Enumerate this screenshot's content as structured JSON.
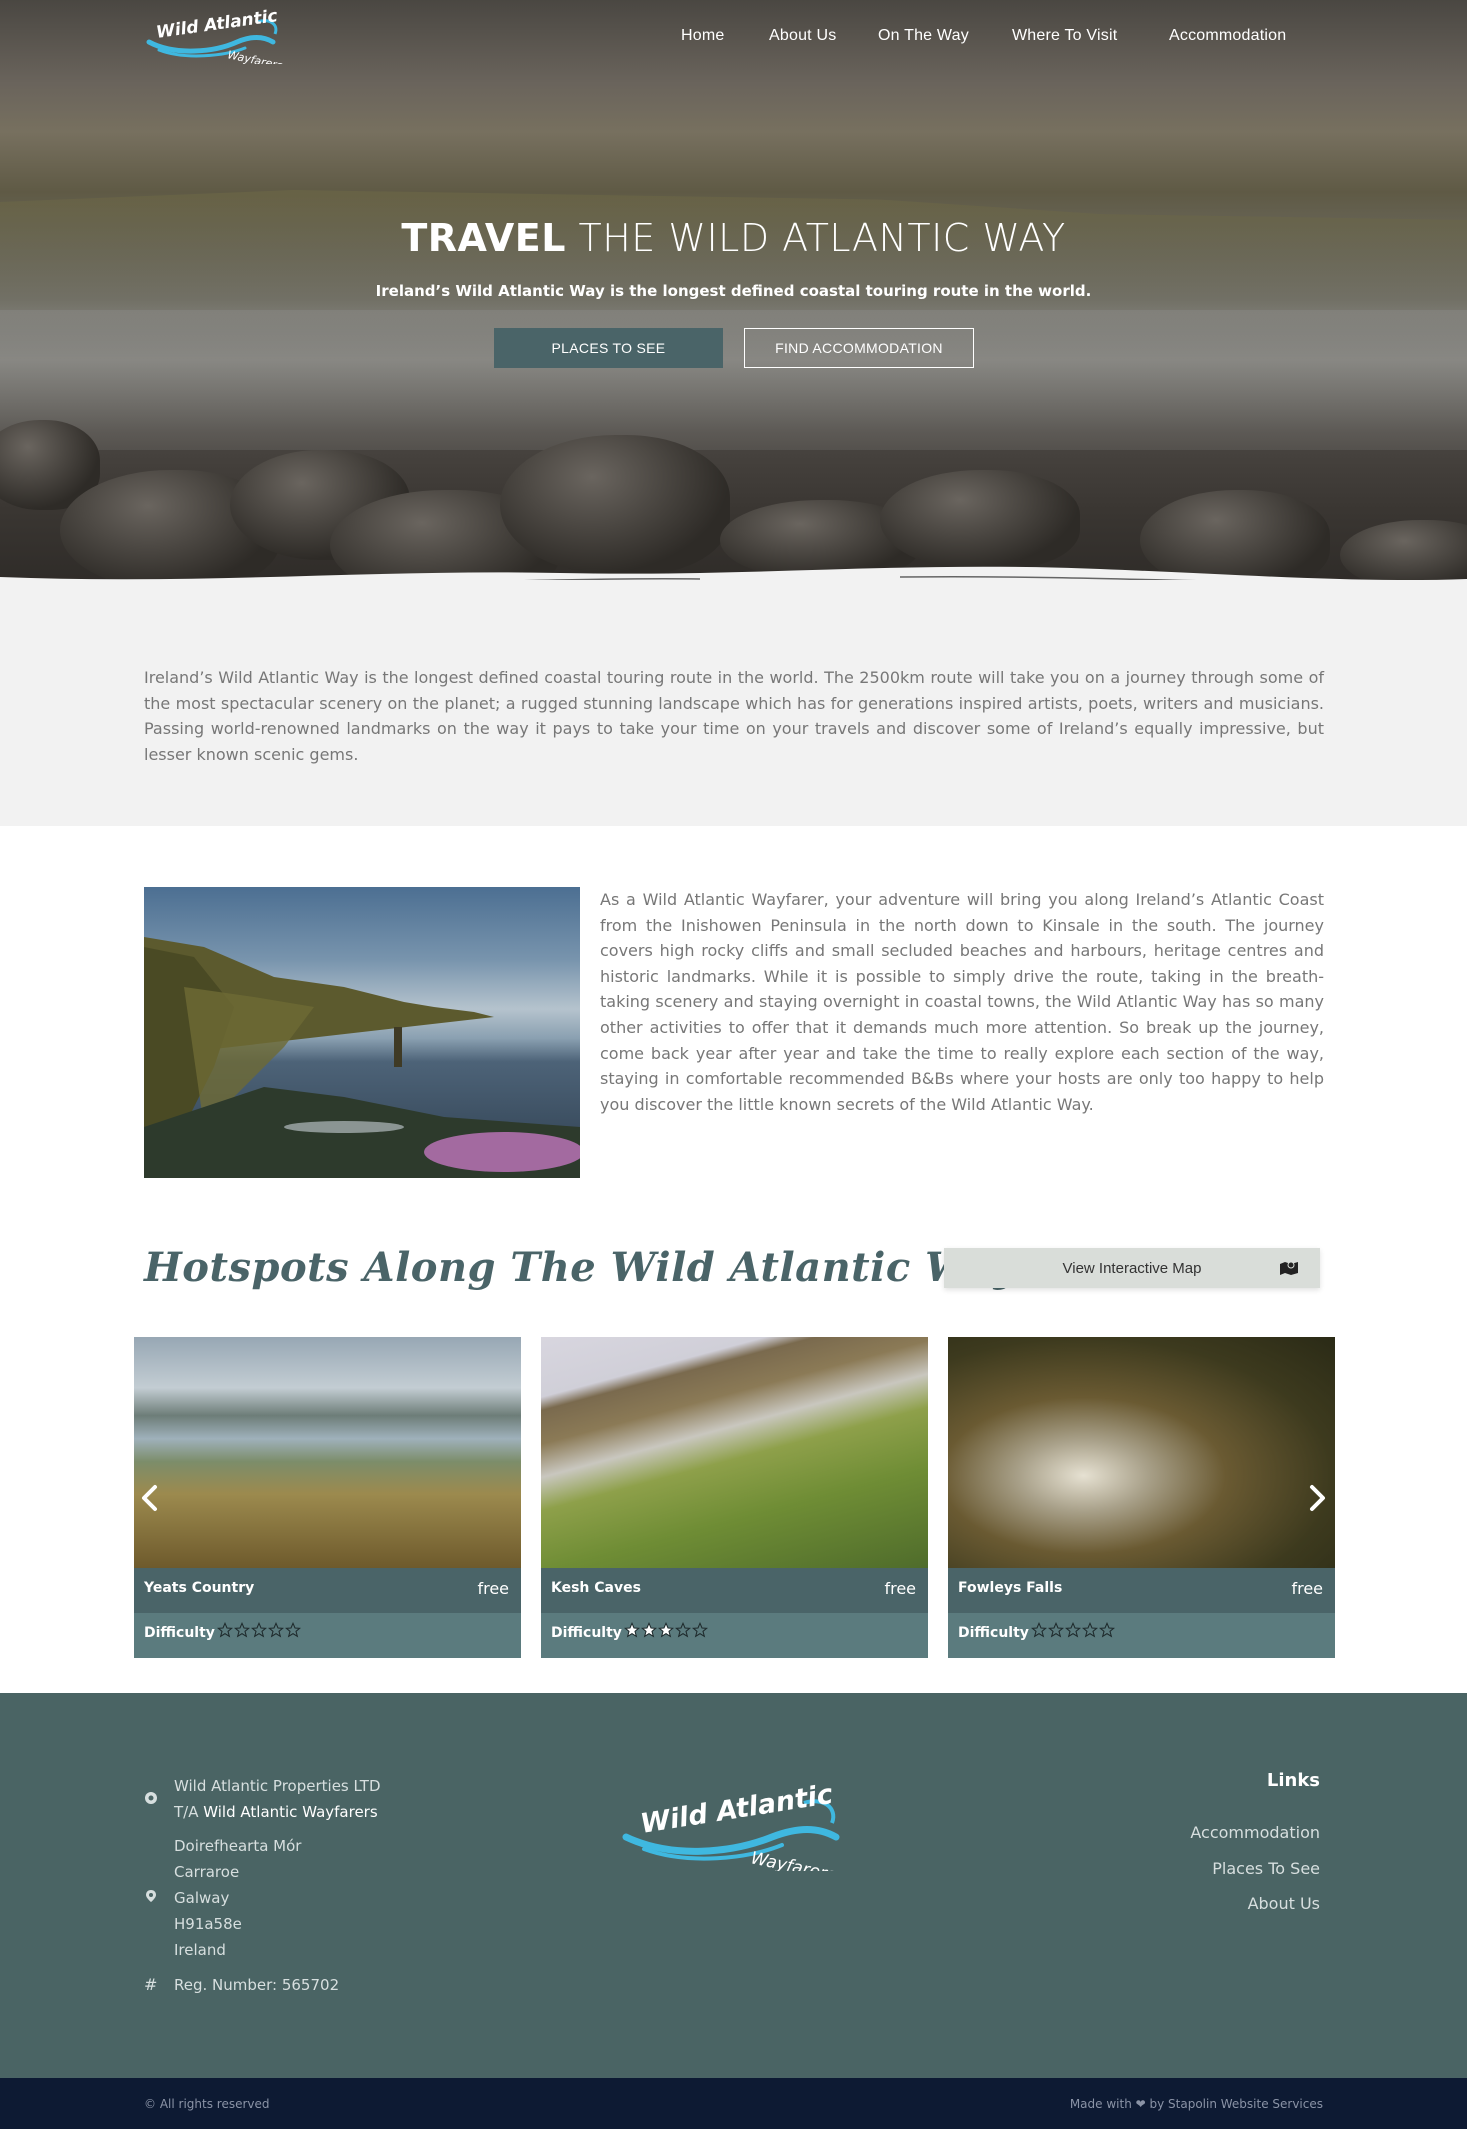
{
  "brand": {
    "logo_line1": "Wild Atlantic",
    "logo_line2": "Wayfarers"
  },
  "nav": {
    "items": [
      {
        "label": "Home"
      },
      {
        "label": "About Us"
      },
      {
        "label": "On The Way"
      },
      {
        "label": "Where To Visit"
      },
      {
        "label": "Accommodation"
      }
    ]
  },
  "hero": {
    "title_bold": "TRAVEL",
    "title_light": "THE WILD ATLANTIC WAY",
    "subtitle": "Ireland’s Wild Atlantic Way is the longest defined coastal touring route in the world.",
    "primary_button": "PLACES TO SEE",
    "secondary_button": "FIND ACCOMMODATION"
  },
  "intro": {
    "text": "Ireland’s Wild Atlantic Way is the longest defined coastal touring route in the world. The 2500km route will take you on a journey through some of the most spectacular scenery on the planet; a rugged stunning landscape which has for generations inspired artists, poets, writers and musicians. Passing world-renowned landmarks on the way it pays to take your time on your travels and discover some of Ireland’s equally impressive, but lesser known scenic gems."
  },
  "about": {
    "text": "As a Wild Atlantic Wayfarer, your adventure will bring you along Ireland’s Atlantic Coast from the Inishowen Peninsula in the north down to Kinsale in the south. The journey covers high rocky cliffs and small secluded beaches and harbours, heritage centres and historic landmarks. While it is possible to simply drive the route, taking in the breath-taking scenery and staying overnight in coastal towns, the Wild Atlantic Way has so many other activities to offer that it demands much more attention. So break up the journey, come back year after year and take the time to really explore each section of the way, staying in comfortable recommended B&Bs where your hosts are only too happy to help you discover the little known secrets of the Wild Atlantic Way."
  },
  "hotspots": {
    "title": "Hotspots Along The Wild Atlantic Way",
    "map_button": "View Interactive Map",
    "difficulty_label": "Difficulty",
    "cards": [
      {
        "name": "Yeats Country",
        "price": "free",
        "difficulty": 0
      },
      {
        "name": "Kesh Caves",
        "price": "free",
        "difficulty": 3
      },
      {
        "name": "Fowleys Falls",
        "price": "free",
        "difficulty": 0
      }
    ]
  },
  "footer": {
    "company": "Wild Atlantic Properties LTD",
    "ta_prefix": "T/A",
    "ta_name": "Wild Atlantic Wayfarers",
    "address": [
      "Doirefhearta Mór",
      "Carraroe",
      "Galway",
      "H91a58e",
      "Ireland"
    ],
    "reg": "Reg. Number: 565702",
    "links_title": "Links",
    "links": [
      "Accommodation",
      "Places To See",
      "About Us"
    ],
    "copyright": "© All rights reserved",
    "made_with": "Made with ❤ by Stapolin Website Services"
  },
  "colors": {
    "accent": "#4a6468",
    "footer_bg": "#4a6464",
    "bottom_bar": "#0d1a33",
    "logo_blue": "#3fb8e0"
  }
}
